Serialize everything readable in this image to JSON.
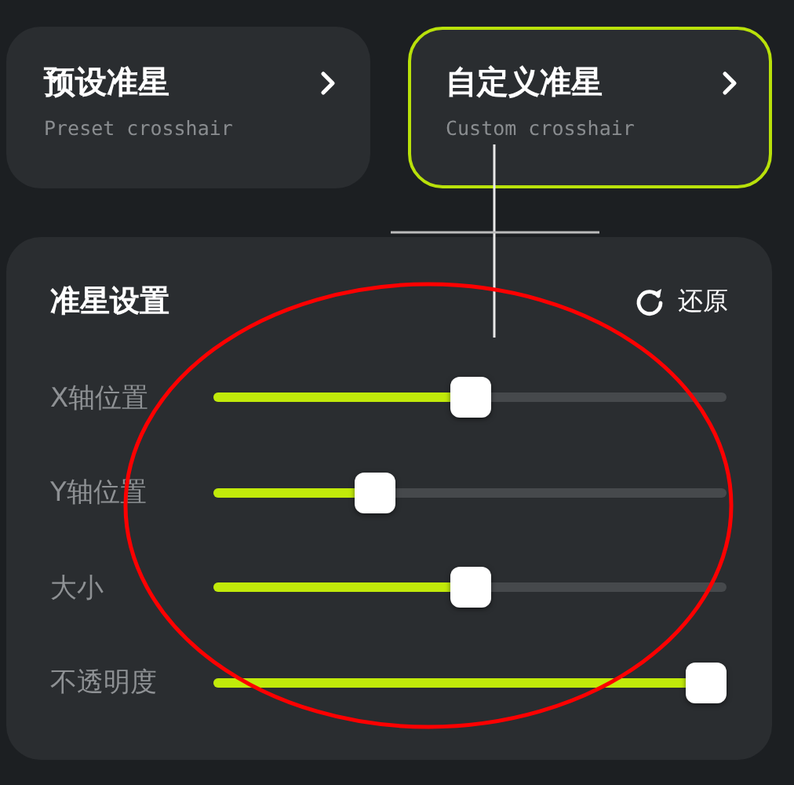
{
  "crosshair_types": [
    {
      "title": "预设准星",
      "subtitle": "Preset crosshair",
      "selected": false
    },
    {
      "title": "自定义准星",
      "subtitle": "Custom crosshair",
      "selected": true
    }
  ],
  "settings": {
    "title": "准星设置",
    "reset_label": "还原",
    "sliders": [
      {
        "label": "X轴位置",
        "level": 0.5
      },
      {
        "label": "Y轴位置",
        "level": 0.3
      },
      {
        "label": "大小",
        "level": 0.5
      },
      {
        "label": "不透明度",
        "level": 1
      }
    ]
  }
}
